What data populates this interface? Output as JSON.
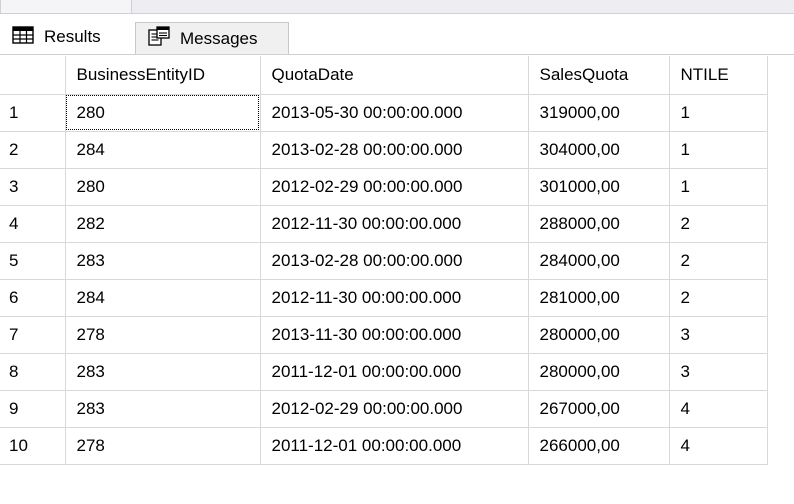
{
  "tabs": {
    "results_label": "Results",
    "messages_label": "Messages",
    "results_icon": "grid-icon",
    "messages_icon": "messages-icon"
  },
  "grid": {
    "columns": [
      "",
      "BusinessEntityID",
      "QuotaDate",
      "SalesQuota",
      "NTILE"
    ],
    "rows": [
      [
        "1",
        "280",
        "2013-05-30 00:00:00.000",
        "319000,00",
        "1"
      ],
      [
        "2",
        "284",
        "2013-02-28 00:00:00.000",
        "304000,00",
        "1"
      ],
      [
        "3",
        "280",
        "2012-02-29 00:00:00.000",
        "301000,00",
        "1"
      ],
      [
        "4",
        "282",
        "2012-11-30 00:00:00.000",
        "288000,00",
        "2"
      ],
      [
        "5",
        "283",
        "2013-02-28 00:00:00.000",
        "284000,00",
        "2"
      ],
      [
        "6",
        "284",
        "2012-11-30 00:00:00.000",
        "281000,00",
        "2"
      ],
      [
        "7",
        "278",
        "2013-11-30 00:00:00.000",
        "280000,00",
        "3"
      ],
      [
        "8",
        "283",
        "2011-12-01 00:00:00.000",
        "280000,00",
        "3"
      ],
      [
        "9",
        "283",
        "2012-02-29 00:00:00.000",
        "267000,00",
        "4"
      ],
      [
        "10",
        "278",
        "2011-12-01 00:00:00.000",
        "266000,00",
        "4"
      ]
    ]
  }
}
